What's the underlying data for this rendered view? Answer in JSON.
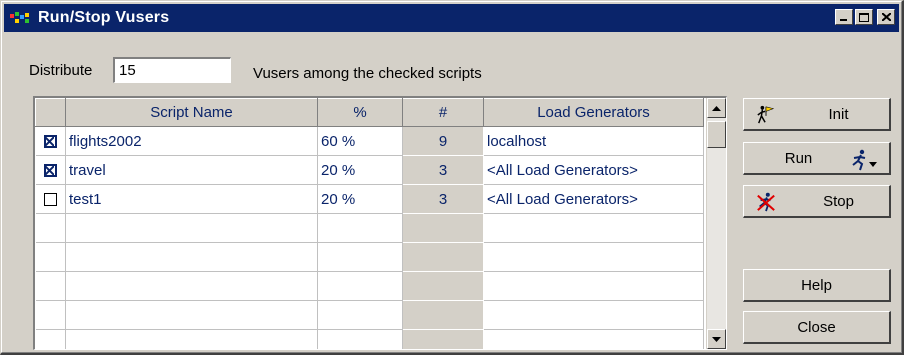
{
  "window": {
    "title": "Run/Stop Vusers",
    "controls": [
      "minimize",
      "maximize",
      "close"
    ]
  },
  "distribute": {
    "label": "Distribute",
    "value": "15",
    "suffix": "Vusers among the checked scripts"
  },
  "grid": {
    "columns": [
      "",
      "Script Name",
      "%",
      "#",
      "Load Generators"
    ],
    "rows": [
      {
        "checked": true,
        "script": "flights2002",
        "percent": "60 %",
        "count": "9",
        "load_generators": "localhost"
      },
      {
        "checked": true,
        "script": "travel",
        "percent": "20 %",
        "count": "3",
        "load_generators": "<All Load Generators>"
      },
      {
        "checked": false,
        "script": "test1",
        "percent": "20 %",
        "count": "3",
        "load_generators": "<All Load Generators>"
      }
    ],
    "empty_rows": 5
  },
  "buttons": {
    "init": "Init",
    "run": "Run",
    "stop": "Stop",
    "help": "Help",
    "close": "Close"
  },
  "colors": {
    "titlebar": "#0a246a",
    "face": "#d4d0c8",
    "text_accent": "#0a246a"
  },
  "icons": {
    "app": "app-logo-icon",
    "init": "runner-flag-icon",
    "run": "running-man-dropdown-icon",
    "stop": "stop-runner-icon"
  }
}
